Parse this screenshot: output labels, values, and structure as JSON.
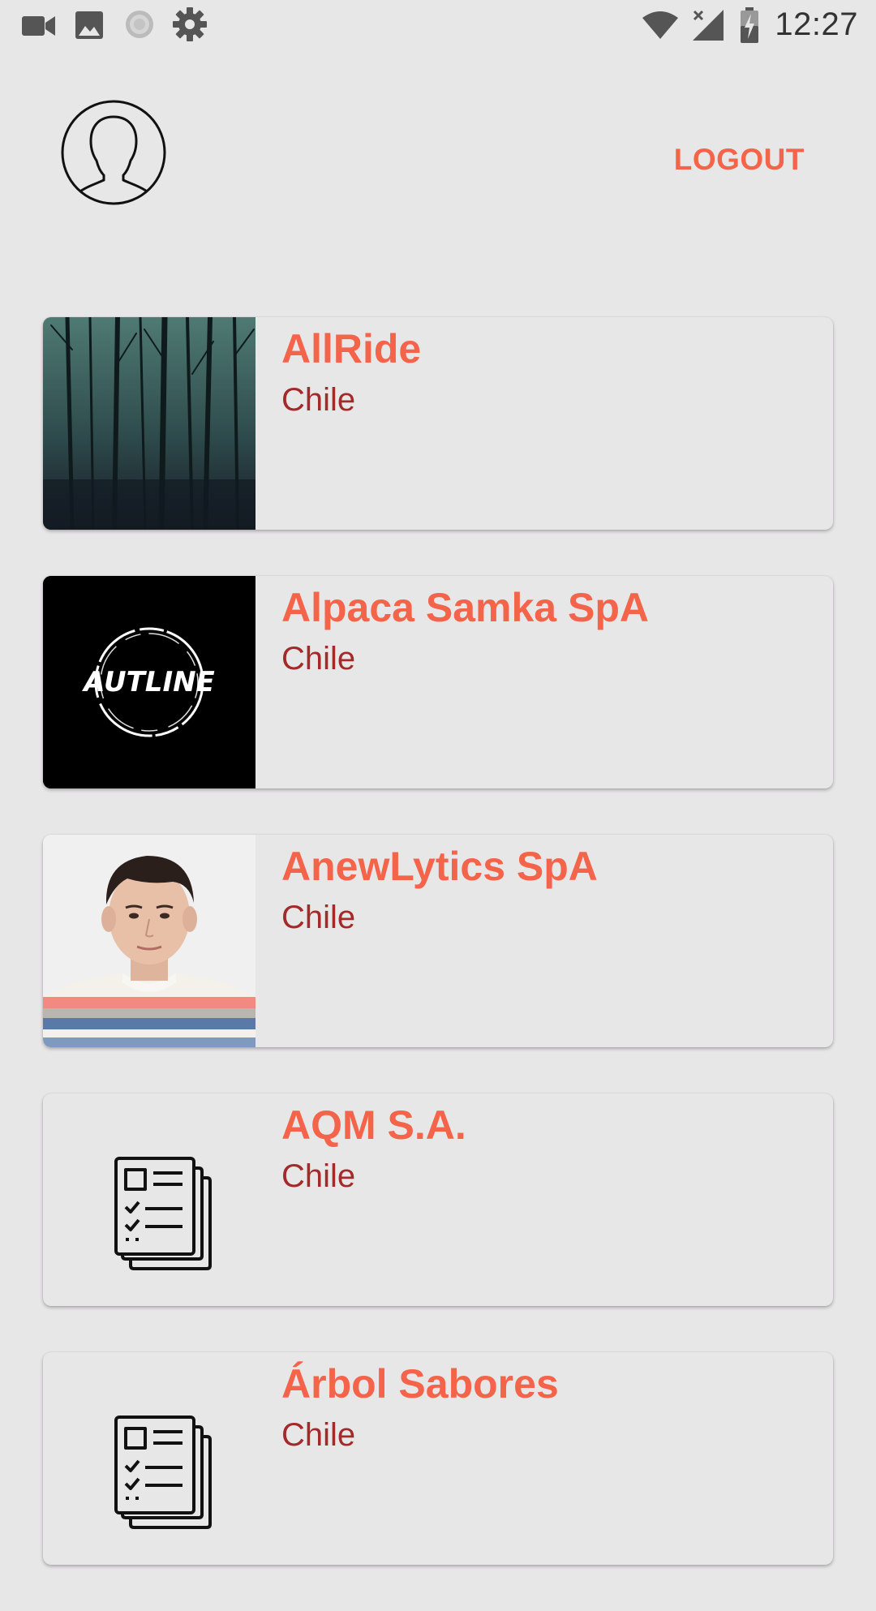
{
  "status_bar": {
    "time": "12:27",
    "left_icons": [
      "video-camera-icon",
      "image-icon",
      "sync-loading-icon",
      "settings-gear-icon"
    ],
    "right_icons": [
      "wifi-icon",
      "cellular-no-signal-icon",
      "battery-charging-icon"
    ]
  },
  "header": {
    "avatar_icon": "user-avatar-icon",
    "logout_label": "LOGOUT",
    "accent_color": "#f4644a"
  },
  "companies": [
    {
      "name": "AllRide",
      "country": "Chile",
      "thumbnail": "dark-forest-photo"
    },
    {
      "name": "Alpaca Samka SpA",
      "country": "Chile",
      "thumbnail": "autline-logo"
    },
    {
      "name": "AnewLytics SpA",
      "country": "Chile",
      "thumbnail": "person-photo"
    },
    {
      "name": "AQM S.A.",
      "country": "Chile",
      "thumbnail": "document-checklist-icon"
    },
    {
      "name": "Árbol Sabores",
      "country": "Chile",
      "thumbnail": "document-checklist-icon"
    }
  ],
  "autline_logo_text": "AUTLINE",
  "colors": {
    "title": "#f4644a",
    "subtitle": "#a32a2a",
    "background": "#e8e7e8"
  }
}
